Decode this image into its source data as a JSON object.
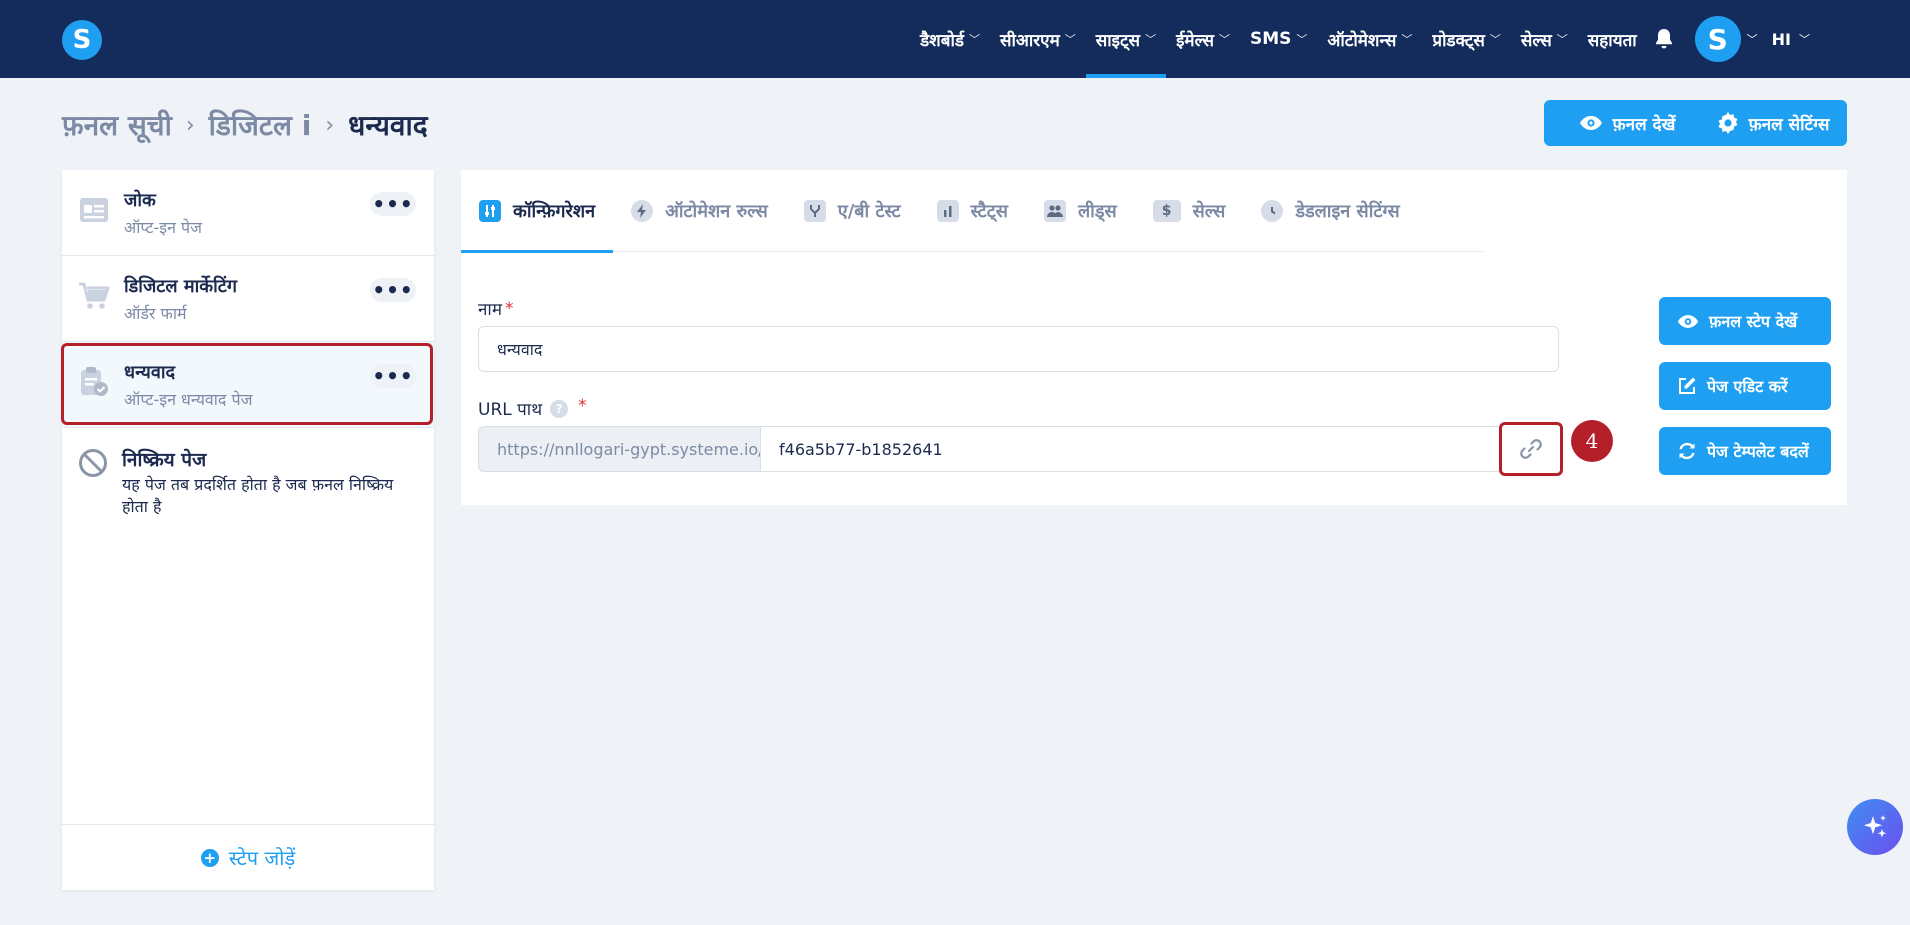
{
  "header": {
    "logo_letter": "S",
    "nav": [
      {
        "label": "डैशबोर्ड"
      },
      {
        "label": "सीआरएम"
      },
      {
        "label": "साइट्स"
      },
      {
        "label": "ईमेल्स"
      },
      {
        "label": "SMS"
      },
      {
        "label": "ऑटोमेशन्स"
      },
      {
        "label": "प्रोडक्ट्स"
      },
      {
        "label": "सेल्स"
      },
      {
        "label": "सहायता"
      }
    ],
    "active_nav": "साइट्स",
    "avatar_letter": "S",
    "language": "HI"
  },
  "breadcrumb": {
    "items": [
      "फ़नल सूची",
      "डिजिटल i",
      "धन्यवाद"
    ]
  },
  "actions": {
    "view_funnel": "फ़नल देखें",
    "funnel_settings": "फ़नल सेटिंग्स"
  },
  "steps": [
    {
      "title": "जोक",
      "subtitle": "ऑप्ट-इन पेज"
    },
    {
      "title": "डिजिटल मार्केटिंग",
      "subtitle": "ऑर्डर फार्म"
    },
    {
      "title": "धन्यवाद",
      "subtitle": "ऑप्ट-इन धन्यवाद पेज"
    }
  ],
  "inactive_page": {
    "title": "निष्क्रिय पेज",
    "description": "यह पेज तब प्रदर्शित होता है जब फ़नल निष्क्रिय होता है"
  },
  "add_step_label": "स्टेप जोड़ें",
  "tabs": [
    {
      "label": "कॉन्फ़िगरेशन"
    },
    {
      "label": "ऑटोमेशन रुल्स"
    },
    {
      "label": "ए/बी टेस्ट"
    },
    {
      "label": "स्टैट्स"
    },
    {
      "label": "लीड्स"
    },
    {
      "label": "सेल्स"
    },
    {
      "label": "डेडलाइन सेटिंग्स"
    }
  ],
  "form": {
    "name_label": "नाम",
    "name_value": "धन्यवाद",
    "required_mark": "*",
    "url_label": "URL पाथ",
    "help_mark": "?",
    "url_prefix": "https://nnllogari-gypt.systeme.io/",
    "url_value": "f46a5b77-b1852641"
  },
  "annotation_number": "4",
  "side_buttons": {
    "view_step": "फ़नल स्टेप देखें",
    "edit_page": "पेज एडिट करें",
    "change_template": "पेज टेम्पलेट बदलें"
  },
  "colors": {
    "nav_bg": "#142c5c",
    "accent": "#1e9ff2",
    "highlight": "#b3202a",
    "page_bg": "#eff3f8"
  },
  "icons": {
    "bell": "bell-icon",
    "eye": "eye-icon",
    "gear": "gear-icon",
    "link": "link-icon",
    "edit": "edit-icon",
    "refresh": "refresh-icon",
    "sparkle": "sparkle-icon"
  }
}
